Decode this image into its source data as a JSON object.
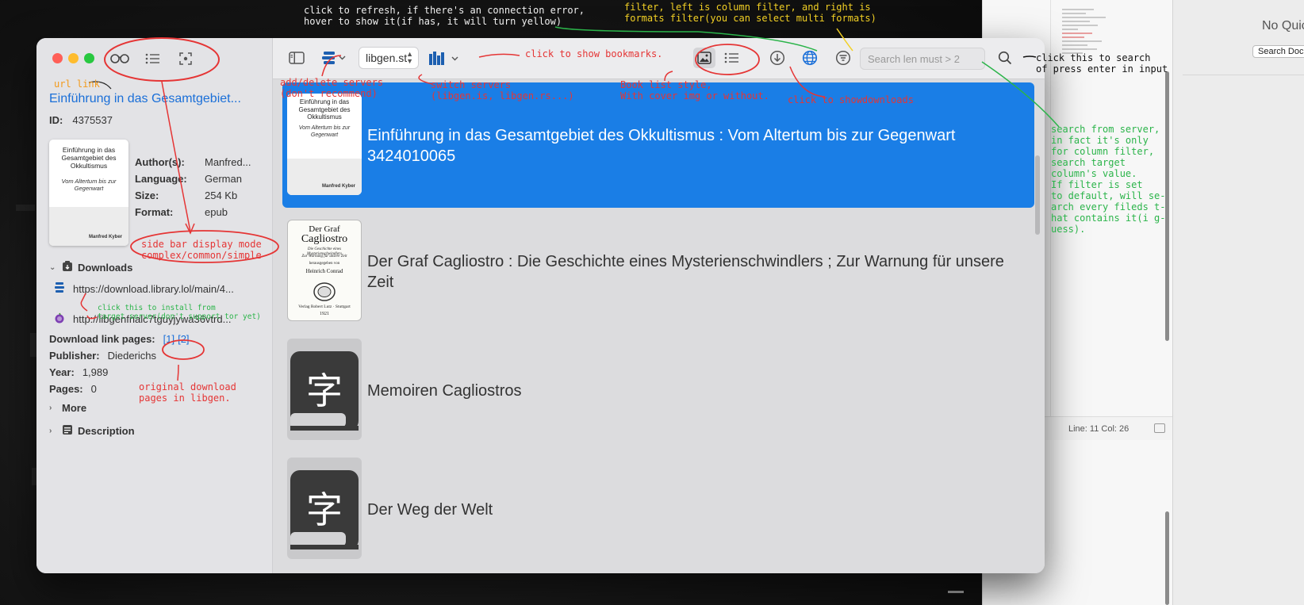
{
  "sidebar": {
    "url_link": "Einführung in das Gesamtgebiet...",
    "id_label": "ID:",
    "id_value": "4375537",
    "cover": {
      "title": "Einführung in das Gesamtgebiet des Okkultismus",
      "subtitle": "Vom Altertum bis zur Gegenwart",
      "author": "Manfred Kyber"
    },
    "meta": [
      {
        "label": "Author(s):",
        "value": "Manfred..."
      },
      {
        "label": "Language:",
        "value": "German"
      },
      {
        "label": "Size:",
        "value": "254 Kb"
      },
      {
        "label": "Format:",
        "value": "epub"
      }
    ],
    "downloads_heading": "Downloads",
    "downloads": [
      "https://download.library.lol/main/4...",
      "http://libgenfrialc7tguyjywa36vtrd..."
    ],
    "link_pages_label": "Download link pages:",
    "link_pages": [
      "[1]",
      "[2]"
    ],
    "publisher_label": "Publisher:",
    "publisher_value": "Diederichs",
    "year_label": "Year:",
    "year_value": "1,989",
    "pages_label": "Pages:",
    "pages_value": "0",
    "more_label": "More",
    "description_label": "Description"
  },
  "toolbar": {
    "server": "libgen.st",
    "search_placeholder": "Search len must > 2"
  },
  "books": [
    {
      "title": "Einführung in das Gesamtgebiet des Okkultismus : Vom Altertum bis zur Gegenwart 3424010065",
      "selected": true
    },
    {
      "title": "Der Graf Cagliostro : Die Geschichte eines Mysterienschwindlers ; Zur Warnung für unsere Zeit",
      "selected": false
    },
    {
      "title": "Memoiren Cagliostros",
      "selected": false
    },
    {
      "title": "Der Weg der Welt",
      "selected": false
    }
  ],
  "covers": {
    "cagliostro": {
      "title1": "Der Graf",
      "title2": "Cagliostro",
      "line1": "Die Geschichte eines Mysterienschwindlers",
      "line2": "Zur Warnung für unsere Zeit",
      "line3": "herausgegeben von",
      "line4": "Heinrich Conrad",
      "publisher": "Verlag Robert Lutz · Stuttgart",
      "year": "1921"
    },
    "placeholder_glyph": "字"
  },
  "background_app": {
    "status": "Line: 11  Col: 26",
    "no_quick": "No Quic",
    "search_doc": "Search Doc"
  },
  "annotations": {
    "refresh": "click to refresh, if there's an connection error,\nhover to show it(if has, it will turn yellow)",
    "filter": "filter, left is column filter, and right is\nformats filter(you can select multi formats)",
    "search_btn": "click this to search\nof press enter in input",
    "url_link": "url link",
    "bookmarks": "click to show bookmarks.",
    "servers_add": "add/delete servers\n(don't recommend)",
    "servers_switch": "switch servers\n(libgen.is, libgen.rs...)",
    "list_style": "Book list style,\nWith cover img or without.",
    "downloads": "click to showdownloads",
    "search_server": "search from server,\nin fact it's only\nfor column filter,\nsearch target\ncolumn's value.\nIf filter is set\nto default, will se-\narch every fileds t-\nhat contains it(i g-\nuess).",
    "sidebar_mode": "side bar display mode\ncomplex/common/simple",
    "install": "click this to install from\ntarget server(don't support tor yet)",
    "original_pages": "original download\npages in libgen."
  },
  "colors": {
    "accent": "#1a7ee6",
    "link": "#1a6fd8",
    "annotation_red": "#e53535",
    "annotation_green": "#2bb44a",
    "annotation_yellow": "#f2d024"
  }
}
